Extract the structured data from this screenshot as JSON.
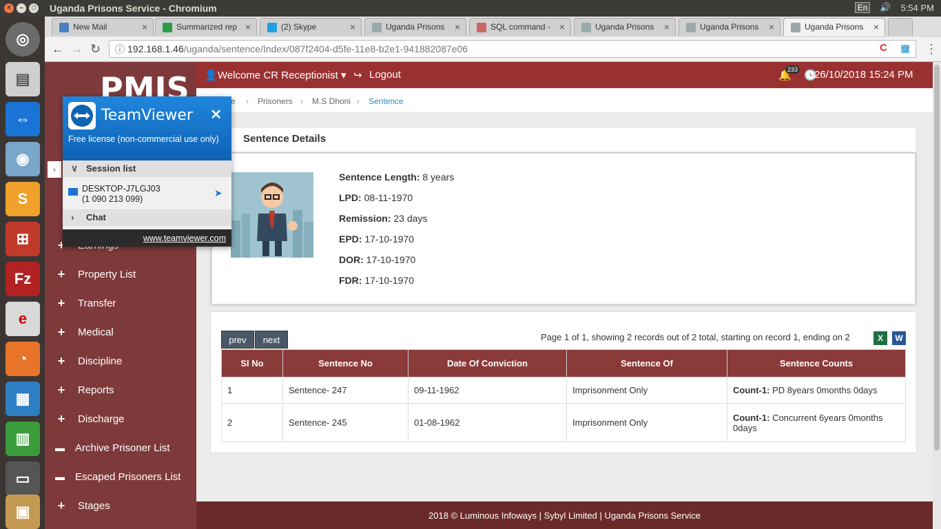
{
  "os": {
    "window_title": "Uganda Prisons Service - Chromium",
    "lang": "En",
    "clock": "5:54 PM"
  },
  "tabs": [
    {
      "label": "New Mail",
      "icon": "ox-icon"
    },
    {
      "label": "Summarized rep",
      "icon": "sheets-icon"
    },
    {
      "label": "(2) Skype",
      "icon": "skype-icon"
    },
    {
      "label": "Uganda Prisons",
      "icon": "page-icon"
    },
    {
      "label": "SQL command -",
      "icon": "sql-icon"
    },
    {
      "label": "Uganda Prisons",
      "icon": "page-icon"
    },
    {
      "label": "Uganda Prisons",
      "icon": "page-icon"
    },
    {
      "label": "Uganda Prisons",
      "icon": "page-icon"
    }
  ],
  "address": {
    "host": "192.168.1.46",
    "path": "/uganda/sentence/Index/087f2404-d5fe-11e8-b2e1-941882087e06"
  },
  "app": {
    "logo": "PMIS",
    "welcome": "Welcome CR Receptionist",
    "logout": "Logout",
    "notif_count": "233",
    "datetime": "26/10/2018 15:24 PM"
  },
  "breadcrumb": [
    "e",
    "Prisoners",
    "M.S Dhoni",
    "Sentence"
  ],
  "sidebar": {
    "items": [
      {
        "label": "Earnings",
        "kind": "plus"
      },
      {
        "label": "Property List",
        "kind": "plus"
      },
      {
        "label": "Transfer",
        "kind": "plus"
      },
      {
        "label": "Medical",
        "kind": "plus"
      },
      {
        "label": "Discipline",
        "kind": "plus"
      },
      {
        "label": "Reports",
        "kind": "plus"
      },
      {
        "label": "Discharge",
        "kind": "plus"
      },
      {
        "label": "Archive Prisoner List",
        "kind": "folder"
      },
      {
        "label": "Escaped Prisoners List",
        "kind": "folder"
      },
      {
        "label": "Stages",
        "kind": "plus"
      }
    ]
  },
  "sentence_details": {
    "title": "Sentence Details",
    "fields": [
      {
        "label": "Sentence Length:",
        "value": "8 years"
      },
      {
        "label": "LPD:",
        "value": "08-11-1970"
      },
      {
        "label": "Remission:",
        "value": "23 days"
      },
      {
        "label": "EPD:",
        "value": "17-10-1970"
      },
      {
        "label": "DOR:",
        "value": "17-10-1970"
      },
      {
        "label": "FDR:",
        "value": "17-10-1970"
      }
    ]
  },
  "pager": {
    "prev": "prev",
    "next": "next",
    "info": "Page 1 of 1, showing 2 records out of 2 total, starting on record 1, ending on 2"
  },
  "table": {
    "headers": [
      "Sl No",
      "Sentence No",
      "Date Of Conviction",
      "Sentence Of",
      "Sentence Counts"
    ],
    "rows": [
      {
        "sl": "1",
        "no": "Sentence- 247",
        "date": "09-11-1962",
        "of": "Imprisonment Only",
        "count_label": "Count-1:",
        "count": "PD 8years 0months 0days"
      },
      {
        "sl": "2",
        "no": "Sentence- 245",
        "date": "01-08-1962",
        "of": "Imprisonment Only",
        "count_label": "Count-1:",
        "count": "Concurrent 6years 0months 0days"
      }
    ]
  },
  "footer": "2018 © Luminous Infoways  |  Sybyl Limited  |  Uganda Prisons Service",
  "teamviewer": {
    "name": "TeamViewer",
    "license": "Free license (non-commercial use only)",
    "session_list": "Session list",
    "device": "DESKTOP-J7LGJ03",
    "device_id": "(1 090 213 099)",
    "chat": "Chat",
    "link": "www.teamviewer.com"
  },
  "colors": {
    "header": "#9a3131",
    "sidebar": "#7e3a3a",
    "table_head": "#8b3a3a",
    "teamviewer": "#0e62b4"
  }
}
